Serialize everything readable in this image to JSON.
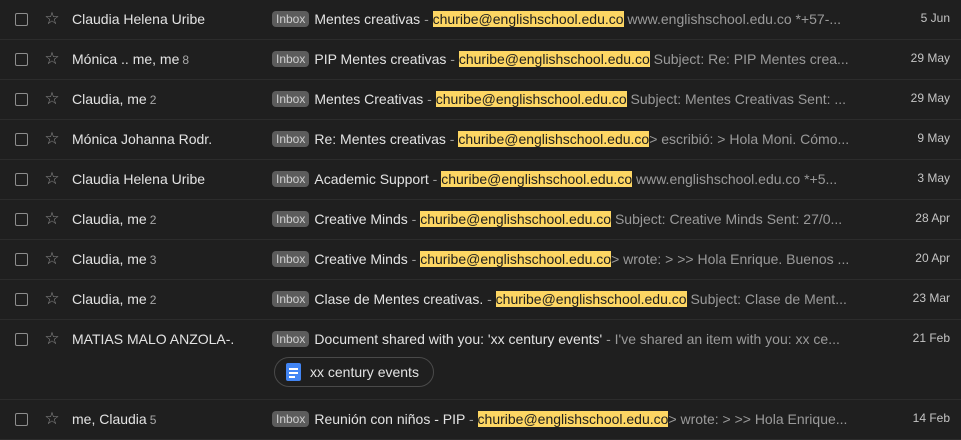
{
  "rows": [
    {
      "sender": "Claudia Helena Uribe",
      "count": "",
      "badge": "Inbox",
      "subject": "Mentes creativas",
      "sep": " - ",
      "highlight": "churibe@englishschool.edu.co",
      "snippet": " www.englishschool.edu.co *+57-...",
      "date": "5 Jun"
    },
    {
      "sender": "Mónica .. me, me",
      "count": "8",
      "badge": "Inbox",
      "subject": "PIP Mentes creativas",
      "sep": " - ",
      "highlight": "churibe@englishschool.edu.co",
      "snippet": " Subject: Re: PIP Mentes crea...",
      "date": "29 May"
    },
    {
      "sender": "Claudia, me",
      "count": "2",
      "badge": "Inbox",
      "subject": "Mentes Creativas",
      "sep": " - ",
      "highlight": "churibe@englishschool.edu.co",
      "snippet": " Subject: Mentes Creativas Sent: ...",
      "date": "29 May"
    },
    {
      "sender": "Mónica Johanna Rodr.",
      "count": "",
      "badge": "Inbox",
      "subject": "Re: Mentes creativas",
      "sep": " - ",
      "highlight": "churibe@englishschool.edu.co",
      "snippet": "> escribió: > Hola Moni. Cómo...",
      "date": "9 May"
    },
    {
      "sender": "Claudia Helena Uribe",
      "count": "",
      "badge": "Inbox",
      "subject": "Academic Support",
      "sep": " - ",
      "highlight": "churibe@englishschool.edu.co",
      "snippet": " www.englishschool.edu.co *+5...",
      "date": "3 May"
    },
    {
      "sender": "Claudia, me",
      "count": "2",
      "badge": "Inbox",
      "subject": "Creative Minds",
      "sep": " - ",
      "highlight": "churibe@englishschool.edu.co",
      "snippet": " Subject: Creative Minds Sent: 27/0...",
      "date": "28 Apr"
    },
    {
      "sender": "Claudia, me",
      "count": "3",
      "badge": "Inbox",
      "subject": "Creative Minds",
      "sep": " - ",
      "highlight": "churibe@englishschool.edu.co",
      "snippet": "> wrote: > >> Hola Enrique. Buenos ...",
      "date": "20 Apr"
    },
    {
      "sender": "Claudia, me",
      "count": "2",
      "badge": "Inbox",
      "subject": "Clase de Mentes creativas.",
      "sep": " - ",
      "highlight": "churibe@englishschool.edu.co",
      "snippet": " Subject: Clase de Ment...",
      "date": "23 Mar"
    },
    {
      "sender": "MATIAS MALO ANZOLA-.",
      "count": "",
      "badge": "Inbox",
      "subject": "Document shared with you: 'xx century events'",
      "sep": " - ",
      "highlight": "",
      "snippet": "I've shared an item with you: xx ce...",
      "date": "21 Feb",
      "attachment": "xx century events"
    },
    {
      "sender": "me, Claudia",
      "count": "5",
      "badge": "Inbox",
      "subject": "Reunión con niños - PIP",
      "sep": " - ",
      "highlight": "churibe@englishschool.edu.co",
      "snippet": "> wrote: > >> Hola Enrique...",
      "date": "14 Feb"
    }
  ],
  "icons": {
    "checkbox": "checkbox-icon",
    "star": "star-outline-icon",
    "doc": "google-docs-icon"
  },
  "colors": {
    "background": "#1f1f1f",
    "highlight": "#fdd663",
    "badge": "#5c5c5c",
    "doc": "#4285f4"
  }
}
